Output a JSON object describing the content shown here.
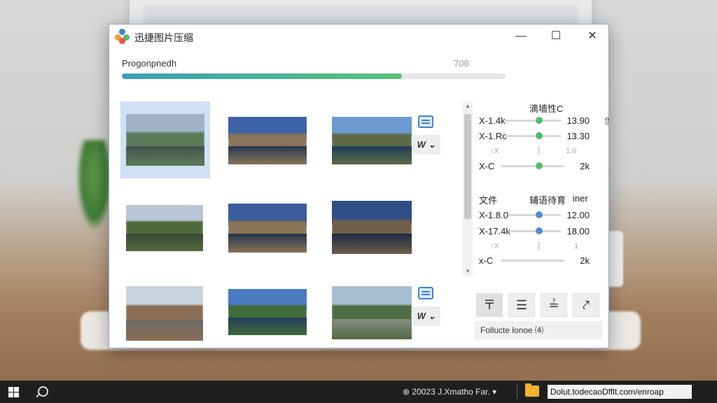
{
  "window": {
    "title": "迅捷图片压缩",
    "controls": {
      "minimize": "—",
      "maximize": "☐",
      "close": "✕"
    }
  },
  "progress": {
    "label": "Progonpnedh",
    "value_text": "706",
    "fraction": 0.73
  },
  "thumbnails": [
    {
      "scene": "mountain-lake",
      "colors": [
        "#9fb2c7",
        "#5b7a58",
        "#41544e"
      ]
    },
    {
      "scene": "castle-water",
      "colors": [
        "#3d63a8",
        "#8a7558",
        "#27384f"
      ]
    },
    {
      "scene": "castle-garden",
      "colors": [
        "#6c9bd1",
        "#5d6a45",
        "#1f3d5c"
      ]
    },
    {
      "scene": "palace-garden",
      "colors": [
        "#b8c6d8",
        "#4f6b3c",
        "#3a4a3a"
      ]
    },
    {
      "scene": "castle-water",
      "colors": [
        "#3a5d9a",
        "#8a7356",
        "#22344c"
      ]
    },
    {
      "scene": "castle-night-water",
      "colors": [
        "#2e4f86",
        "#6e5e4a",
        "#1b2b44"
      ]
    },
    {
      "scene": "street-buildings",
      "colors": [
        "#c9d4de",
        "#8c6e54",
        "#6a6a66"
      ]
    },
    {
      "scene": "castle-lake",
      "colors": [
        "#4a7bc2",
        "#3f6b3a",
        "#243c5a"
      ]
    },
    {
      "scene": "mountain-road",
      "colors": [
        "#a7bfd2",
        "#4f6d44",
        "#8a8a84"
      ]
    }
  ],
  "format_dropdown_label": "W",
  "panel": {
    "section1": {
      "heading": "滴墙性C",
      "rows": [
        {
          "label": "X-1.4k",
          "value": "13.90",
          "slider": 0.72
        },
        {
          "label": "X-1.Rc",
          "value": "13.30",
          "slider": 0.72
        },
        {
          "label": "↑X",
          "value": "1.0"
        },
        {
          "label": "X-C",
          "value": "2k",
          "slider": 0.72
        }
      ]
    },
    "section2": {
      "heading_left": "文件",
      "heading_mid": "辅语待育",
      "heading_right": "iner",
      "rows": [
        {
          "label": "X-1.8.0",
          "value": "12.00",
          "slider": 0.72
        },
        {
          "label": "X-17.4k",
          "value": "18.00",
          "slider": 0.72
        },
        {
          "label": "↑X",
          "value": "1"
        },
        {
          "label": "x-C",
          "value": "2k",
          "slider": 0.72
        }
      ]
    },
    "toolbar": [
      {
        "name": "align-top-icon",
        "glyph": "〒"
      },
      {
        "name": "menu-lines-icon",
        "glyph": "☰"
      },
      {
        "name": "align-split-icon",
        "glyph": "≟"
      },
      {
        "name": "pin-icon",
        "glyph": "⤤"
      }
    ],
    "footer_text": "Follucte lonoe ⑷"
  },
  "colors": {
    "accent": "#3f85d0",
    "knob_green": "#4fbf6a",
    "knob_blue": "#4f8fd8",
    "progress_start": "#3a9fb8",
    "progress_end": "#5cc27a"
  },
  "taskbar": {
    "tray_text": "⊕ 20023 J.Xmatho Far.",
    "tray_caret": "▾",
    "tray_box_text": "Dolut.todecaoDfflt.com/enroap"
  }
}
